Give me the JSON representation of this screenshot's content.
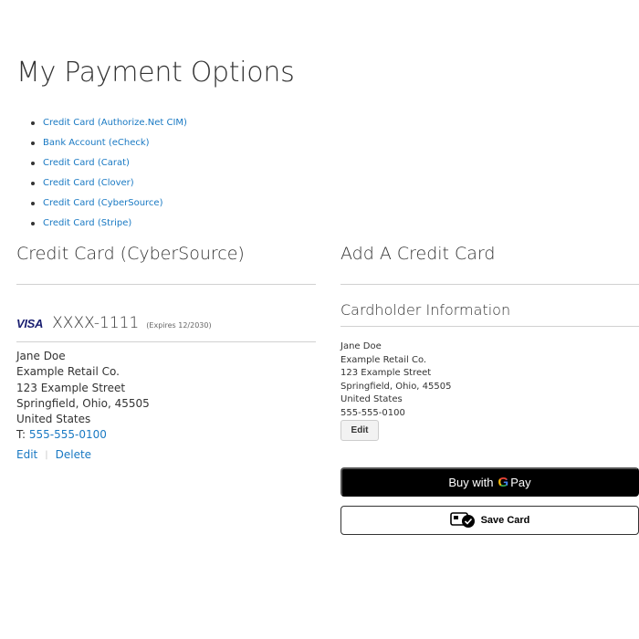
{
  "page": {
    "title": "My Payment Options"
  },
  "payment_methods": [
    "Credit Card (Authorize.Net CIM)",
    "Bank Account (eCheck)",
    "Credit Card (Carat)",
    "Credit Card (Clover)",
    "Credit Card (CyberSource)",
    "Credit Card (Stripe)"
  ],
  "saved_section": {
    "title": "Credit Card (CyberSource)",
    "card": {
      "brand": "VISA",
      "number": "XXXX-1111",
      "expires": "(Expires 12/2030)"
    },
    "address": {
      "name": "Jane Doe",
      "company": "Example Retail Co.",
      "street": "123 Example Street",
      "city_line": "Springfield, Ohio, 45505",
      "country": "United States",
      "phone_prefix": "T: ",
      "phone": "555-555-0100"
    },
    "actions": {
      "edit": "Edit",
      "delete": "Delete"
    }
  },
  "add_section": {
    "title": "Add A Credit Card",
    "subtitle": "Cardholder Information",
    "holder": {
      "name": "Jane Doe",
      "company": "Example Retail Co.",
      "street": "123 Example Street",
      "city_line": "Springfield, Ohio, 45505",
      "country": "United States",
      "phone": "555-555-0100"
    },
    "edit_label": "Edit",
    "gpay": {
      "prefix": "Buy with",
      "g": "G",
      "pay": "Pay"
    },
    "save_label": "Save Card"
  },
  "colors": {
    "link": "#1979c3",
    "visa": "#1a1f71",
    "gpay_bg": "#000000"
  }
}
